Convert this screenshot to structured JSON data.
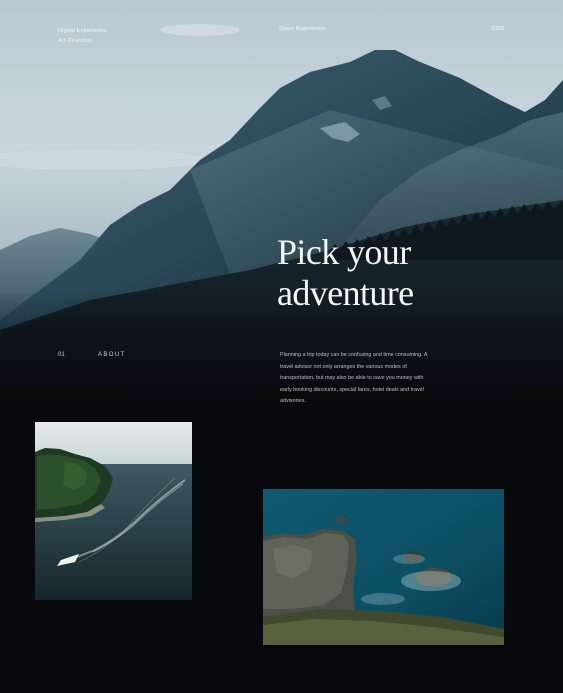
{
  "header": {
    "tagline_line1": "Digital Experience",
    "tagline_line2": "Art Direction",
    "author": "Slava Bogomolov",
    "year": "2020"
  },
  "hero": {
    "headline_line1": "Pick your",
    "headline_line2": "adventure"
  },
  "section": {
    "number": "01",
    "label": "ABOUT",
    "body": "Planning a trip today can be confusing and time consuming. A travel advisor not only arranges the various modes of transportation, but may also be able to save you money with early booking discounts, special fares, hotel deals and travel advisories."
  },
  "colors": {
    "background": "#07090c",
    "text": "#f4f6f7",
    "muted_text": "#b9c1c8"
  }
}
